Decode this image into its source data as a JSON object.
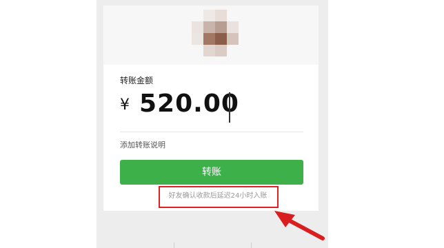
{
  "transfer": {
    "amount_label": "转账金额",
    "currency_symbol": "¥",
    "amount_value": "520.00",
    "add_note_link": "添加转账说明",
    "confirm_button": "转账",
    "delay_notice": "好友确认收款后延迟24小时入账"
  },
  "colors": {
    "button_green": "#3eb04a",
    "highlight_red": "#e02020"
  },
  "icons": {
    "avatar": "blurred-avatar-icon",
    "annotation_arrow": "red-arrow-icon"
  }
}
